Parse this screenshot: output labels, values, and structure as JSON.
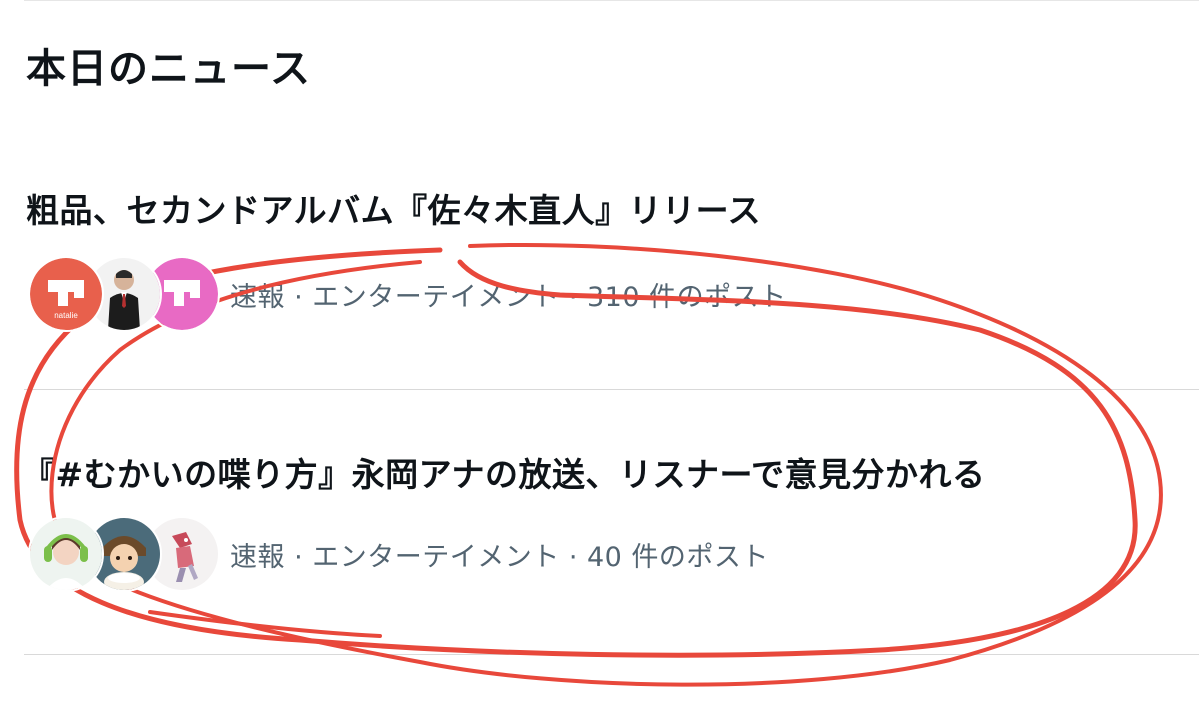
{
  "section_title": "本日のニュース",
  "news": [
    {
      "headline": "粗品、セカンドアルバム『佐々木直人』リリース",
      "meta": "速報 · エンターテイメント · 310 件のポスト",
      "avatars": [
        "natalie-logo-avatar",
        "person-in-suit-avatar",
        "natalie-logo-pink-avatar"
      ],
      "avatar_text": "natalie"
    },
    {
      "headline": "『#むかいの喋り方』永岡アナの放送、リスナーで意見分かれる",
      "meta": "速報 · エンターテイメント · 40 件のポスト",
      "avatars": [
        "woman-headphones-avatar",
        "anime-character-avatar",
        "robot-illustration-avatar"
      ]
    }
  ],
  "colors": {
    "accent_red": "#e8483b",
    "natalie_red": "#e8604c",
    "natalie_pink": "#e86ac4",
    "meta_gray": "#536471",
    "divider": "#d9d9d9"
  }
}
